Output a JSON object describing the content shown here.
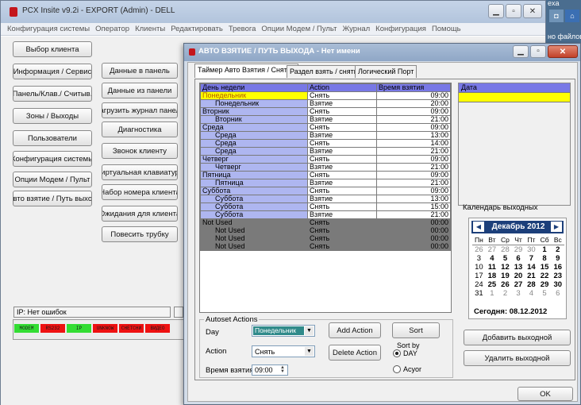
{
  "main_window": {
    "title": "PCX Insite v9.2i - EXPORT (Admin) - DELL",
    "menu": [
      "Конфигурация системы",
      "Оператор",
      "Клиенты",
      "Редактировать",
      "Тревога",
      "Опции Модем / Пульт",
      "Журнал",
      "Конфигурация",
      "Помощь"
    ],
    "left_buttons": [
      "Выбор клиента",
      "Информация / Сервис",
      "Панель/Клав./ Считыв.",
      "Зоны / Выходы",
      "Пользователи",
      "Конфигурация системы",
      "Опции Модем / Пульт",
      "ъвто взятие / Путь выход"
    ],
    "middle_buttons": [
      "Данные в панель",
      "Данные из панели",
      "Загрузить журнал панели",
      "Диагностика",
      "Звонок клиенту",
      "Виртуальная клавиатура",
      "Набор номера клиента",
      "Ожидания для клиента",
      "Повесить трубку"
    ],
    "status": "IP: Нет ошибок",
    "indicators": [
      {
        "label": "MODEM",
        "color": "#33dd33"
      },
      {
        "label": "RS232",
        "color": "#ee1111"
      },
      {
        "label": "IP",
        "color": "#33dd33"
      },
      {
        "label": "UNKNOW",
        "color": "#ee1111"
      },
      {
        "label": "СНЕТСНИ",
        "color": "#ee1111"
      },
      {
        "label": "ВИДЕО",
        "color": "#ee1111"
      }
    ]
  },
  "right_edge": {
    "top_text": "exa",
    "bottom_text": "но файлов:"
  },
  "dialog": {
    "title": "АВТО ВЗЯТИЕ / ПУТЬ ВЫХОДА - Нет имени",
    "tabs": [
      "Таймер Авто Взятия / Снятия",
      "Раздел взять / снять",
      "Логический Порт"
    ],
    "grid": {
      "headers": [
        "День недели",
        "Action",
        "Время взятия"
      ],
      "rows": [
        {
          "day": "Понедельник",
          "action": "Снять",
          "time": "09:00",
          "indent": false,
          "style": "selected"
        },
        {
          "day": "Понедельник",
          "action": "Взятие",
          "time": "20:00",
          "indent": true,
          "style": "normal"
        },
        {
          "day": "Вторник",
          "action": "Снять",
          "time": "09:00",
          "indent": false,
          "style": "normal"
        },
        {
          "day": "Вторник",
          "action": "Взятие",
          "time": "21:00",
          "indent": true,
          "style": "normal"
        },
        {
          "day": "Среда",
          "action": "Снять",
          "time": "09:00",
          "indent": false,
          "style": "normal"
        },
        {
          "day": "Среда",
          "action": "Взятие",
          "time": "13:00",
          "indent": true,
          "style": "normal"
        },
        {
          "day": "Среда",
          "action": "Снять",
          "time": "14:00",
          "indent": true,
          "style": "normal"
        },
        {
          "day": "Среда",
          "action": "Взятие",
          "time": "21:00",
          "indent": true,
          "style": "normal"
        },
        {
          "day": "Четверг",
          "action": "Снять",
          "time": "09:00",
          "indent": false,
          "style": "normal"
        },
        {
          "day": "Четверг",
          "action": "Взятие",
          "time": "21:00",
          "indent": true,
          "style": "normal"
        },
        {
          "day": "Пятница",
          "action": "Снять",
          "time": "09:00",
          "indent": false,
          "style": "normal"
        },
        {
          "day": "Пятница",
          "action": "Взятие",
          "time": "21:00",
          "indent": true,
          "style": "normal"
        },
        {
          "day": "Суббота",
          "action": "Снять",
          "time": "09:00",
          "indent": false,
          "style": "normal"
        },
        {
          "day": "Суббота",
          "action": "Взятие",
          "time": "13:00",
          "indent": true,
          "style": "normal"
        },
        {
          "day": "Суббота",
          "action": "Снять",
          "time": "15:00",
          "indent": true,
          "style": "normal"
        },
        {
          "day": "Суббота",
          "action": "Взятие",
          "time": "21:00",
          "indent": true,
          "style": "normal"
        },
        {
          "day": "Not Used",
          "action": "Снять",
          "time": "00:00",
          "indent": false,
          "style": "unused"
        },
        {
          "day": "Not Used",
          "action": "Снять",
          "time": "00:00",
          "indent": true,
          "style": "unused"
        },
        {
          "day": "Not Used",
          "action": "Снять",
          "time": "00:00",
          "indent": true,
          "style": "unused"
        },
        {
          "day": "Not Used",
          "action": "Снять",
          "time": "00:00",
          "indent": true,
          "style": "unused"
        }
      ]
    },
    "date_header": "Дата",
    "calendar": {
      "label": "Календарь выходных",
      "month": "Декабрь 2012",
      "weekdays": [
        "Пн",
        "Вт",
        "Ср",
        "Чт",
        "Пт",
        "Сб",
        "Вс"
      ],
      "weeks": [
        [
          "26",
          "27",
          "28",
          "29",
          "30",
          "1",
          "2"
        ],
        [
          "3",
          "4",
          "5",
          "6",
          "7",
          "8",
          "9"
        ],
        [
          "10",
          "11",
          "12",
          "13",
          "14",
          "15",
          "16"
        ],
        [
          "17",
          "18",
          "19",
          "20",
          "21",
          "22",
          "23"
        ],
        [
          "24",
          "25",
          "26",
          "27",
          "28",
          "29",
          "30"
        ],
        [
          "31",
          "1",
          "2",
          "3",
          "4",
          "5",
          "6"
        ]
      ],
      "today": "Сегодня: 08.12.2012"
    },
    "add_holiday": "Добавить выходной",
    "remove_holiday": "Удалить выходной",
    "autoset": {
      "legend": "Autoset Actions",
      "day_label": "Day",
      "day_value": "Понедельник",
      "action_label": "Action",
      "action_value": "Снять",
      "time_label": "Время взятия",
      "time_value": "09:00",
      "add_action": "Add Action",
      "delete_action": "Delete Action",
      "sort": "Sort",
      "sort_by": "Sort by",
      "sort_day": "DAY",
      "sort_acyor": "Acyor"
    },
    "ok": "OK"
  }
}
